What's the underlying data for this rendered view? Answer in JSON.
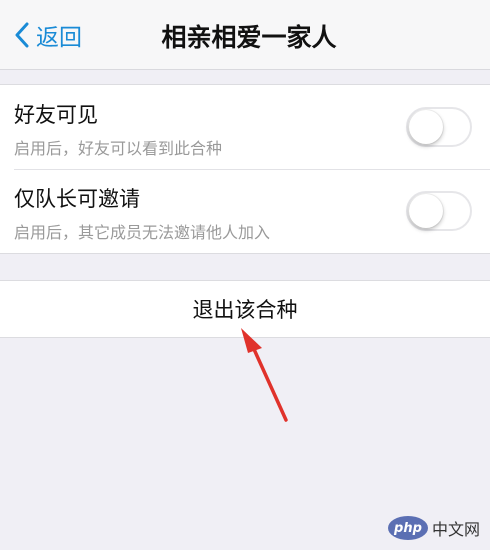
{
  "navbar": {
    "back_label": "返回",
    "title": "相亲相爱一家人"
  },
  "settings": [
    {
      "title": "好友可见",
      "subtitle": "启用后，好友可以看到此合种",
      "enabled": false
    },
    {
      "title": "仅队长可邀请",
      "subtitle": "启用后，其它成员无法邀请他人加入",
      "enabled": false
    }
  ],
  "leave": {
    "label": "退出该合种"
  },
  "annotation": {
    "color": "#e0322b"
  },
  "watermark": {
    "logo": "php",
    "text": "中文网"
  },
  "colors": {
    "accent": "#1a8bd6",
    "background": "#f0eff5"
  }
}
